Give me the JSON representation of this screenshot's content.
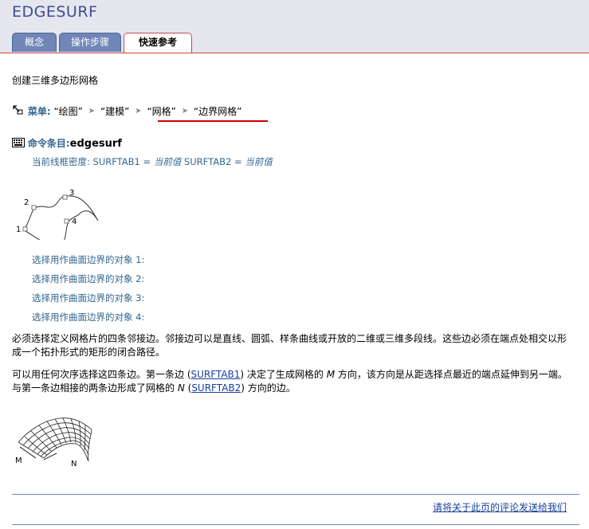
{
  "header": {
    "title": "EDGESURF"
  },
  "tabs": [
    {
      "label": "概念"
    },
    {
      "label": "操作步骤"
    },
    {
      "label": "快速参考"
    }
  ],
  "content": {
    "intro": "创建三维多边形网格",
    "menu": {
      "label": "菜单:",
      "path": [
        "“绘图”",
        "“建模”",
        "“网格”",
        "“边界网格”"
      ]
    },
    "command": {
      "label": "命令条目:",
      "name": "edgesurf",
      "density_prefix": "当前线框密度: SURFTAB1 = ",
      "density_value1": "当前值",
      "density_mid": " SURFTAB2 = ",
      "density_value2": "当前值"
    },
    "figure1_labels": [
      "1",
      "2",
      "3",
      "4"
    ],
    "prompts": [
      "选择用作曲面边界的对象 1:",
      "选择用作曲面边界的对象 2:",
      "选择用作曲面边界的对象 3:",
      "选择用作曲面边界的对象 4:"
    ],
    "para1": "必须选择定义网格片的四条邻接边。邻接边可以是直线、圆弧、样条曲线或开放的二维或三维多段线。这些边必须在端点处相交以形成一个拓扑形式的矩形的闭合路径。",
    "para2": {
      "t1": "可以用任何次序选择这四条边。第一条边 (",
      "link1": "SURFTAB1",
      "t2": ") 决定了生成网格的 ",
      "m": "M",
      "t3": " 方向，该方向是从距选择点最近的端点延伸到另一端。与第一条边相接的两条边形成了网格的 ",
      "n": "N",
      "t4": " (",
      "link2": "SURFTAB2",
      "t5": ") 方向的边。"
    },
    "figure2_labels": [
      "M",
      "N"
    ]
  },
  "footer": {
    "feedback": "请将关于此页的评论发送给我们"
  }
}
